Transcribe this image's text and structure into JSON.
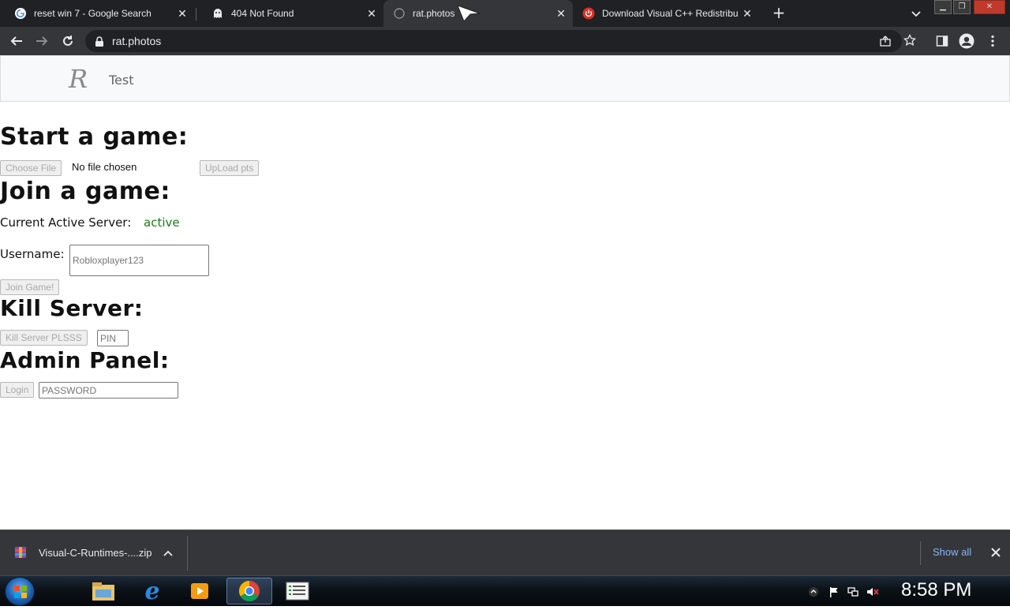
{
  "browser": {
    "tabs": [
      {
        "title": "reset win 7 - Google Search",
        "favicon": "google-icon",
        "active": false
      },
      {
        "title": "404 Not Found",
        "favicon": "ghost-icon",
        "active": false
      },
      {
        "title": "rat.photos",
        "favicon": "globe-icon",
        "active": true
      },
      {
        "title": "Download Visual C++ Redistribu",
        "favicon": "power-icon",
        "active": false
      }
    ],
    "new_tab_label": "+",
    "url": "rat.photos"
  },
  "site": {
    "logo": "R",
    "nav_link": "Test"
  },
  "start_game": {
    "heading": "Start a game:",
    "choose_file_label": "Choose File",
    "no_file_text": "No file chosen",
    "upload_label": "UpLoad pts"
  },
  "join_game": {
    "heading": "Join a game:",
    "server_label": "Current Active Server:",
    "server_status": "active",
    "server_status_color": "#1a7a1a",
    "username_label": "Username:",
    "username_placeholder": "Robloxplayer123",
    "join_label": "Join Game!"
  },
  "kill_server": {
    "heading": "Kill Server:",
    "button_label": "Kill Server PLSSS",
    "pin_placeholder": "PIN"
  },
  "admin_panel": {
    "heading": "Admin Panel:",
    "login_label": "Login",
    "password_placeholder": "PASSWORD"
  },
  "downloads": {
    "file_name": "Visual-C-Runtimes-....zip",
    "show_all_label": "Show all"
  },
  "taskbar": {
    "clock": "8:58 PM"
  }
}
